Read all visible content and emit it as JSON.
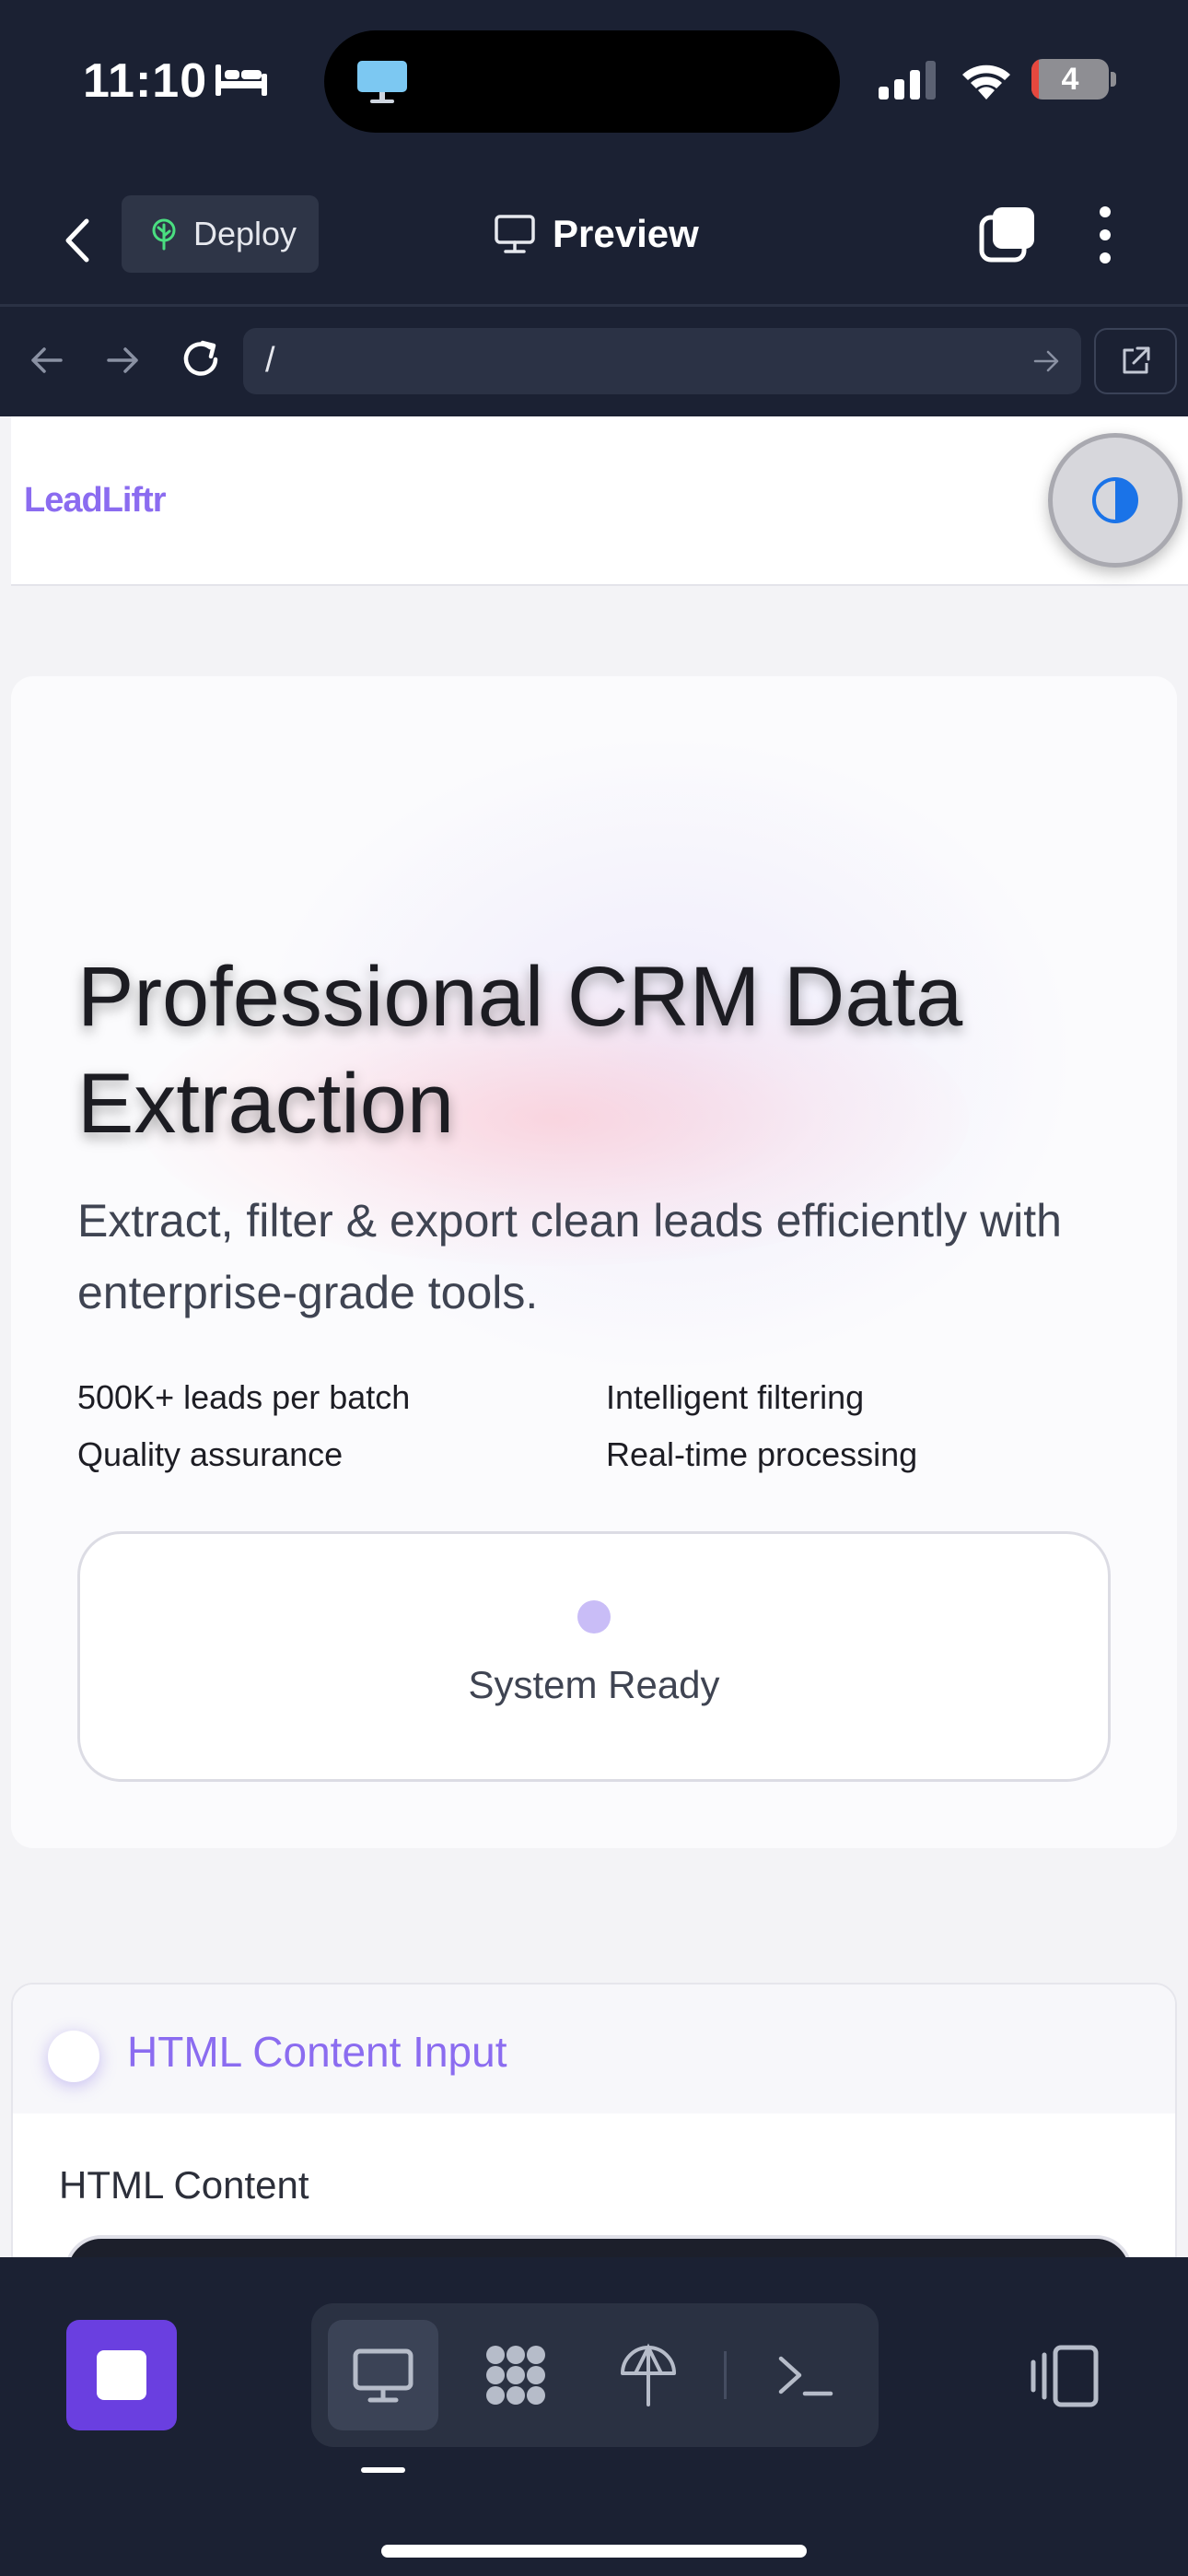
{
  "status_bar": {
    "time": "11:10",
    "battery_level": "4",
    "icons": [
      "bed-icon",
      "monitor-app-icon",
      "cellular-signal-icon",
      "wifi-icon",
      "battery-icon"
    ]
  },
  "toolbar": {
    "deploy_label": "Deploy",
    "preview_label": "Preview",
    "icons": [
      "back-chevron-icon",
      "deploy-tree-icon",
      "monitor-icon",
      "tabs-icon",
      "more-vertical-icon"
    ]
  },
  "browser": {
    "url": "/",
    "icons": [
      "back-arrow-icon",
      "forward-arrow-icon",
      "reload-icon",
      "go-arrow-icon",
      "open-external-icon"
    ]
  },
  "site": {
    "logo": "LeadLiftr",
    "hero": {
      "title": "Professional CRM Data Extraction",
      "subtitle": "Extract, filter & export clean leads efficiently with enterprise-grade tools.",
      "features": [
        "500K+ leads per batch",
        "Intelligent filtering",
        "Quality assurance",
        "Real-time processing"
      ],
      "status": "System Ready"
    },
    "input_card": {
      "title": "HTML Content Input",
      "field_label": "HTML Content"
    }
  },
  "dock": {
    "items": [
      "preview-monitor-icon",
      "workflow-pattern-icon",
      "deploy-icon",
      "terminal-icon"
    ],
    "active": "preview-monitor-icon"
  },
  "colors": {
    "app_bg": "#1b2133",
    "accent_purple": "#8b6cf0",
    "stop_button": "#6a3fe0",
    "deploy_green": "#4ade80",
    "toggle_blue": "#1a73e8"
  }
}
